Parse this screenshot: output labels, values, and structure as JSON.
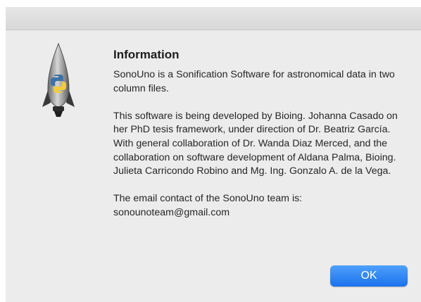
{
  "dialog": {
    "title": "Information",
    "paragraphs": [
      "SonoUno is a Sonification Software for astronomical data in two column files.",
      "This software is being developed by Bioing. Johanna Casado on her PhD tesis framework, under direction of Dr. Beatriz García. With general collaboration of Dr. Wanda Diaz Merced, and the collaboration on software development of Aldana Palma, Bioing. Julieta Carricondo Robino and Mg. Ing. Gonzalo A. de la Vega.",
      "The email contact of the SonoUno team is:"
    ],
    "email": "sonounoteam@gmail.com",
    "ok_label": "OK",
    "icon": "python-rocket-icon"
  },
  "colors": {
    "accent": "#2a7ff3",
    "background": "#ececec",
    "text": "#262626"
  }
}
